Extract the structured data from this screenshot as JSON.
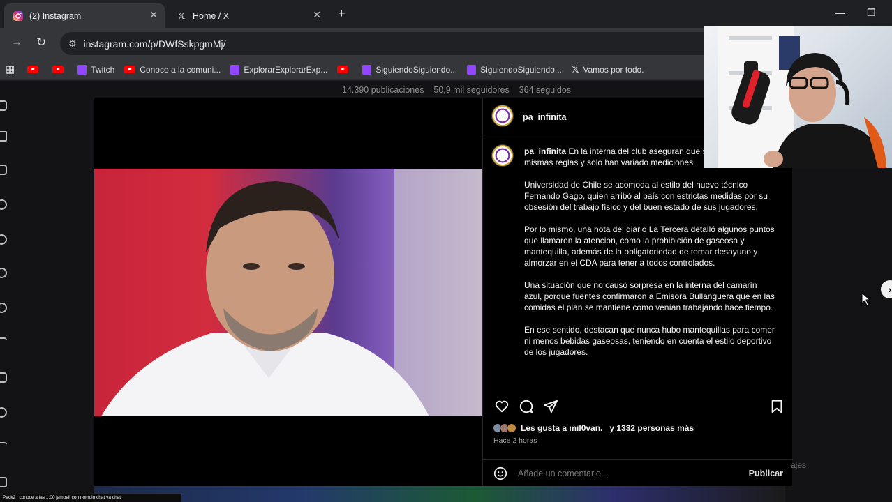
{
  "browser": {
    "tabs": [
      {
        "label": "(2) Instagram",
        "active": true,
        "icon": "instagram-icon"
      },
      {
        "label": "Home / X",
        "active": false,
        "icon": "x-icon"
      }
    ],
    "new_tab": "+",
    "url": "instagram.com/p/DWfSskpgmMj/",
    "bookmarks": [
      {
        "label": "",
        "icon": "youtube-icon"
      },
      {
        "label": "",
        "icon": "youtube-icon"
      },
      {
        "label": "Twitch",
        "icon": "twitch-icon"
      },
      {
        "label": "Conoce a la comuni...",
        "icon": "youtube-icon"
      },
      {
        "label": "ExplorarExplorarExp...",
        "icon": "twitch-icon"
      },
      {
        "label": "",
        "icon": "youtube-icon"
      },
      {
        "label": "SiguiendoSiguiendo...",
        "icon": "twitch-icon"
      },
      {
        "label": "SiguiendoSiguiendo...",
        "icon": "twitch-icon"
      },
      {
        "label": "Vamos por todo.",
        "icon": "x-icon"
      }
    ]
  },
  "profile_stats": {
    "posts": "14.390 publicaciones",
    "followers": "50,9 mil seguidores",
    "following": "364 seguidos"
  },
  "post": {
    "username": "pa_infinita",
    "caption_user": "pa_infinita",
    "caption_paragraphs": [
      "En la interna del club aseguran que se mantienen las mismas reglas y solo han variado mediciones.",
      "Universidad de Chile se acomoda al estilo del nuevo técnico Fernando Gago, quien arribó al país con estrictas medidas por su obsesión del trabajo físico y del buen estado de sus jugadores.",
      "Por lo mismo, una nota del diario La Tercera detalló algunos puntos que llamaron la atención, como la prohibición de gaseosa y mantequilla, además de la obligatoriedad de tomar desayuno y almorzar en el CDA para tener a todos controlados.",
      "Una situación que no causó sorpresa en la interna del camarín azul, porque fuentes confirmaron a Emisora Bullanguera que en las comidas el plan se mantiene como venían trabajando hace tiempo.",
      "En ese sentido, destacan que nunca hubo mantequillas para comer ni menos bebidas gaseosas, teniendo en cuenta el estilo deportivo de los jugadores."
    ],
    "likes_text": "Les gusta a mil0van._ y 1332 personas más",
    "time": "Hace 2 horas",
    "comment_placeholder": "Añade un comentario...",
    "publish_label": "Publicar"
  },
  "side_hint": "ajes",
  "ticker_text": "Pack2 : conoce a las 1:00 jambell con nomolo chat va chat",
  "colors": {
    "instagram_bg": "#000000",
    "publish": "#e0e0e0",
    "youtube": "#ff0000",
    "twitch": "#9146ff"
  }
}
